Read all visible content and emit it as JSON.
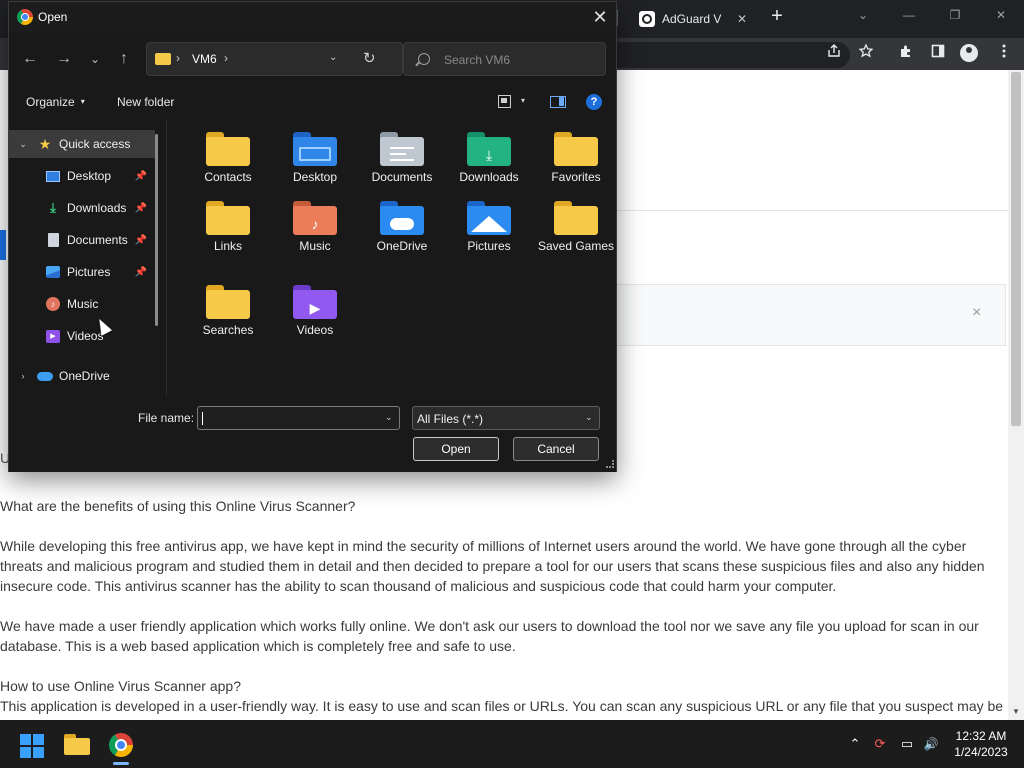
{
  "browser": {
    "tab_title": "AdGuard V",
    "tab_close": "✕",
    "new_tab": "+",
    "window_controls": {
      "caret": "⌄",
      "minimize": "—",
      "restore": "❐",
      "close": "✕"
    },
    "toolbar_icons": [
      "share-icon",
      "star-icon",
      "extensions-icon",
      "sidepanel-icon",
      "profile-icon",
      "menu-icon"
    ]
  },
  "page": {
    "close_box": "×",
    "truncated_left": "U",
    "heading1": "What are the benefits of using this Online Virus Scanner?",
    "para1": "While developing this free antivirus app, we have kept in mind the security of millions of Internet users around the world. We have gone through all the cyber threats and malicious program and studied them in detail and then decided to prepare a tool for our users that scans these suspicious files and also any hidden insecure code. This antivirus scanner has the ability to scan thousand of malicious and suspicious code that could harm your computer.",
    "para2": "We have made a user friendly application which works fully online. We don't ask our users to download the tool nor we save any file you upload for scan in our database. This is a web based application which is completely free and safe to use.",
    "heading2": "How to use Online Virus Scanner app?",
    "para3": "This application is developed in a user-friendly way. It is easy to use and scan files or URLs. You can scan any suspicious URL or any file that you suspect may be"
  },
  "dialog": {
    "title": "Open",
    "close": "✕",
    "nav": {
      "back": "←",
      "forward": "→",
      "recent": "⌄",
      "up": "↑"
    },
    "address": {
      "sep": "›",
      "path": "VM6",
      "dropdown": "⌄",
      "refresh": "↻"
    },
    "search_placeholder": "Search VM6",
    "organize": "Organize",
    "organize_caret": "▾",
    "new_folder": "New folder",
    "view_caret": "▾",
    "help": "?",
    "nav_pane": {
      "expand_open": "⌄",
      "expand_closed": "›",
      "pin": "📌",
      "quick_access": "Quick access",
      "items": [
        "Desktop",
        "Downloads",
        "Documents",
        "Pictures",
        "Music",
        "Videos"
      ],
      "onedrive": "OneDrive",
      "glyphs": {
        "star": "★",
        "download": "⤓",
        "music": "♪",
        "video": "▶"
      }
    },
    "folders": [
      "Contacts",
      "Desktop",
      "Documents",
      "Downloads",
      "Favorites",
      "Links",
      "Music",
      "OneDrive",
      "Pictures",
      "Saved Games",
      "Searches",
      "Videos"
    ],
    "folder_glyphs": {
      "download": "⤓",
      "music": "♪",
      "video": "▶"
    },
    "file_name_label": "File name:",
    "file_name_value": "",
    "dropdown_caret": "⌄",
    "file_type": "All Files (*.*)",
    "open_button": "Open",
    "cancel_button": "Cancel"
  },
  "taskbar": {
    "tray_glyphs": {
      "overflow": "⌃",
      "sync": "⟳",
      "display": "▭",
      "volume": "🔊"
    },
    "time": "12:32 AM",
    "date": "1/24/2023"
  },
  "colors": {
    "dialog_bg": "#191919",
    "folder_yellow": "#f7c948",
    "taskbar_bg": "#1c1c1c",
    "accent": "#1e6fd9"
  }
}
